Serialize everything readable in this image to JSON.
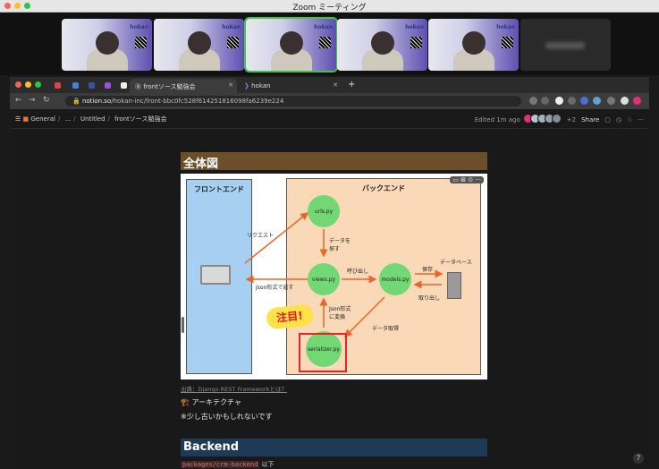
{
  "zoom": {
    "title": "Zoom ミーティング",
    "participants": [
      {
        "logo": "hokan"
      },
      {
        "logo": "hokan"
      },
      {
        "logo": "hokan"
      },
      {
        "logo": "hokan"
      },
      {
        "logo": "hokan"
      },
      {
        "logo": ""
      }
    ],
    "colors": {
      "red": "#ff5f57",
      "yellow": "#febc2e",
      "green": "#28c840",
      "active_border": "#46c24a"
    }
  },
  "browser": {
    "tabs": [
      {
        "label": "frontソース勉強会",
        "active": true
      },
      {
        "label": "hokan",
        "active": false
      }
    ],
    "new_tab": "+",
    "url_domain": "notion.so",
    "url_path": "/hokan-inc/front-bbc0fc528f614251816098fa6239e224"
  },
  "notion": {
    "breadcrumb": [
      "General",
      "...",
      "Untitled",
      "frontソース勉強会"
    ],
    "edited": "Edited 1m ago",
    "extra_count": "+2",
    "share": "Share",
    "heading1": "全体図",
    "heading2": "Backend",
    "caption": "出典：Django REST Frameworkとは？",
    "line1": "🏗️ アーキテクチャ",
    "line2": "※少し古いかもしれないです",
    "code": "packages/crm-backend",
    "code_suffix": "以下",
    "help": "?"
  },
  "diagram": {
    "frontend_title": "フロントエンド",
    "backend_title": "バックエンド",
    "nodes": {
      "urls": "urls.py",
      "views": "views.py",
      "models": "models.py",
      "serializer": "serializer.py"
    },
    "labels": {
      "request": "リクエスト",
      "find_data": "データを\n探す",
      "call": "呼び出し",
      "database": "データベース",
      "save": "保存",
      "take_out": "取り出し",
      "json_return": "Json形式で返す",
      "json_convert": "Json形式\nに変換",
      "data_get": "データ取得",
      "attention": "注目!"
    }
  }
}
